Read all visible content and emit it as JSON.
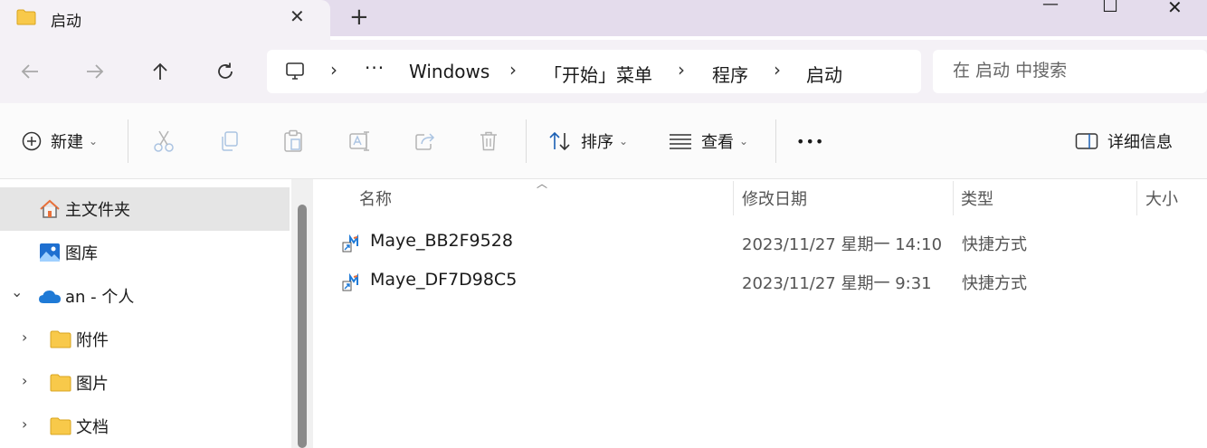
{
  "tab": {
    "title": "启动",
    "close_glyph": "✕",
    "new_tab_glyph": "+"
  },
  "window_controls": {
    "minimize": "—",
    "maximize": "☐",
    "close": "✕"
  },
  "breadcrumbs": [
    "Windows",
    "「开始」菜单",
    "程序",
    "启动"
  ],
  "breadcrumb_more": "···",
  "breadcrumb_separator": "›",
  "search": {
    "placeholder": "在 启动 中搜索"
  },
  "toolbar": {
    "new_label": "新建",
    "sort_label": "排序",
    "view_label": "查看",
    "more_glyph": "•••",
    "details_label": "详细信息",
    "caret": "⌄"
  },
  "sidebar": {
    "items": [
      {
        "label": "主文件夹",
        "icon": "home-icon",
        "selected": true
      },
      {
        "label": "图库",
        "icon": "gallery-icon"
      },
      {
        "label": "an - 个人",
        "icon": "onedrive-cloud-icon",
        "expanded": true
      },
      {
        "label": "附件",
        "icon": "folder-icon"
      },
      {
        "label": "图片",
        "icon": "folder-icon"
      },
      {
        "label": "文档",
        "icon": "folder-icon"
      }
    ],
    "expand_glyph": "›",
    "collapse_glyph": "⌄"
  },
  "columns": {
    "name": "名称",
    "modified": "修改日期",
    "type": "类型",
    "size": "大小"
  },
  "files": [
    {
      "name": "Maye_BB2F9528",
      "modified": "2023/11/27 星期一 14:10",
      "type": "快捷方式"
    },
    {
      "name": "Maye_DF7D98C5",
      "modified": "2023/11/27 星期一 9:31",
      "type": "快捷方式"
    }
  ],
  "colors": {
    "accent": "#0067c0",
    "folder": "#f8c94a",
    "selection": "#e5e5e5"
  }
}
